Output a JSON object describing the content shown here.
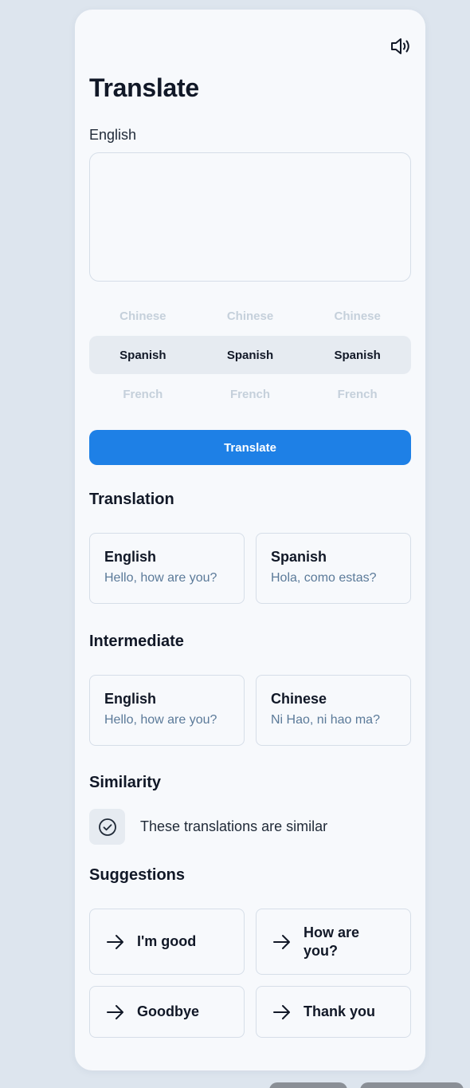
{
  "title": "Translate",
  "source_language": "English",
  "textarea": {
    "value": "",
    "placeholder": ""
  },
  "picker": {
    "columns": 3,
    "above": [
      "Chinese",
      "Chinese",
      "Chinese"
    ],
    "selected": [
      "Spanish",
      "Spanish",
      "Spanish"
    ],
    "below": [
      "French",
      "French",
      "French"
    ]
  },
  "translate_button": "Translate",
  "translation": {
    "heading": "Translation",
    "left": {
      "lang": "English",
      "text": "Hello, how are you?"
    },
    "right": {
      "lang": "Spanish",
      "text": "Hola, como estas?"
    }
  },
  "intermediate": {
    "heading": "Intermediate",
    "left": {
      "lang": "English",
      "text": "Hello, how are you?"
    },
    "right": {
      "lang": "Chinese",
      "text": "Ni Hao, ni hao ma?"
    }
  },
  "similarity": {
    "heading": "Similarity",
    "text": "These translations are similar"
  },
  "suggestions": {
    "heading": "Suggestions",
    "items": [
      "I'm good",
      "How are you?",
      "Goodbye",
      "Thank you"
    ]
  },
  "icons": {
    "speaker": "speaker-icon",
    "check": "check-circle-icon",
    "arrow": "arrow-right-icon"
  },
  "colors": {
    "accent": "#1e80e6",
    "background": "#dde5ee",
    "card": "#f7f9fc",
    "muted_text": "#5b7a99",
    "picker_faded": "#c5d0db"
  }
}
